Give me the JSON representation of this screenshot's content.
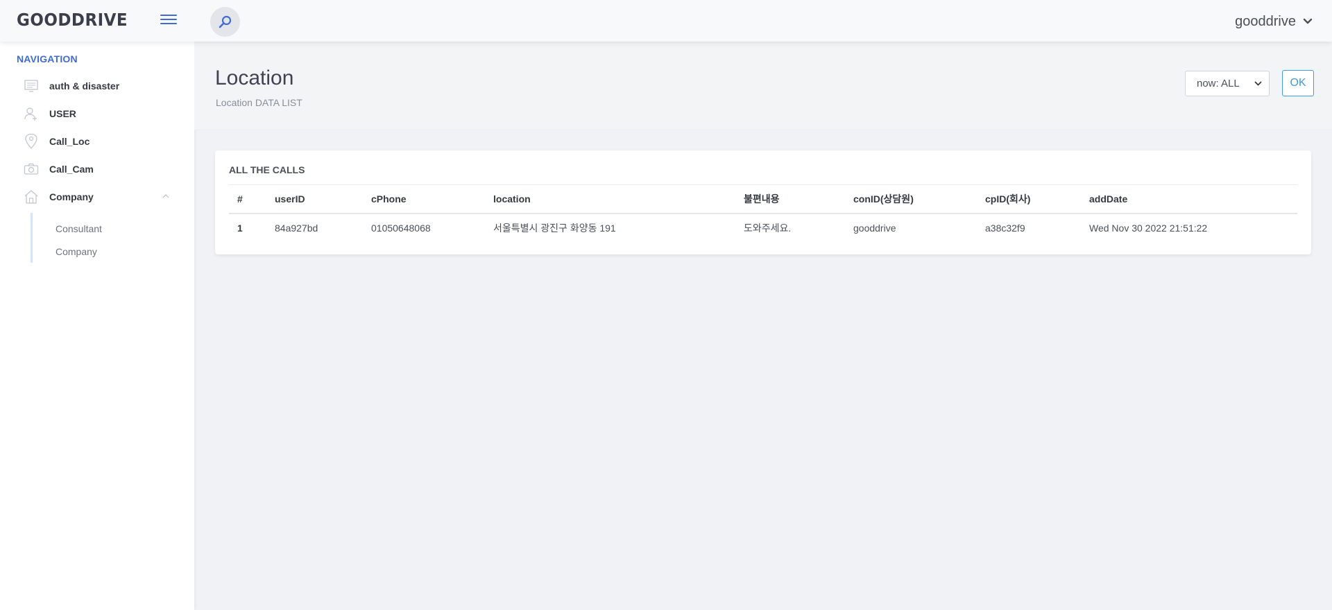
{
  "header": {
    "logo": "GOODDRIVE",
    "user_name": "gooddrive"
  },
  "sidebar": {
    "heading": "NAVIGATION",
    "items": [
      {
        "label": "auth & disaster",
        "icon": "monitor-icon"
      },
      {
        "label": "USER",
        "icon": "user-plus-icon"
      },
      {
        "label": "Call_Loc",
        "icon": "map-pin-icon"
      },
      {
        "label": "Call_Cam",
        "icon": "camera-icon"
      },
      {
        "label": "Company",
        "icon": "home-icon",
        "expanded": true
      }
    ],
    "subitems": [
      {
        "label": "Consultant"
      },
      {
        "label": "Company"
      }
    ]
  },
  "page": {
    "title": "Location",
    "subtitle": "Location DATA LIST",
    "filter_value": "now: ALL",
    "ok_label": "OK"
  },
  "card": {
    "title": "ALL THE CALLS",
    "columns": [
      "#",
      "userID",
      "cPhone",
      "location",
      "불편내용",
      "conID(상담원)",
      "cpID(회사)",
      "addDate"
    ],
    "rows": [
      [
        "1",
        "84a927bd",
        "01050648068",
        "서울특별시 광진구 화양동 191",
        "도와주세요.",
        "gooddrive",
        "a38c32f9",
        "Wed Nov 30 2022 21:51:22"
      ]
    ]
  },
  "colors": {
    "accent": "#3f6ad8",
    "ok_button": "#3f9ae0",
    "background": "#f1f2f5"
  }
}
